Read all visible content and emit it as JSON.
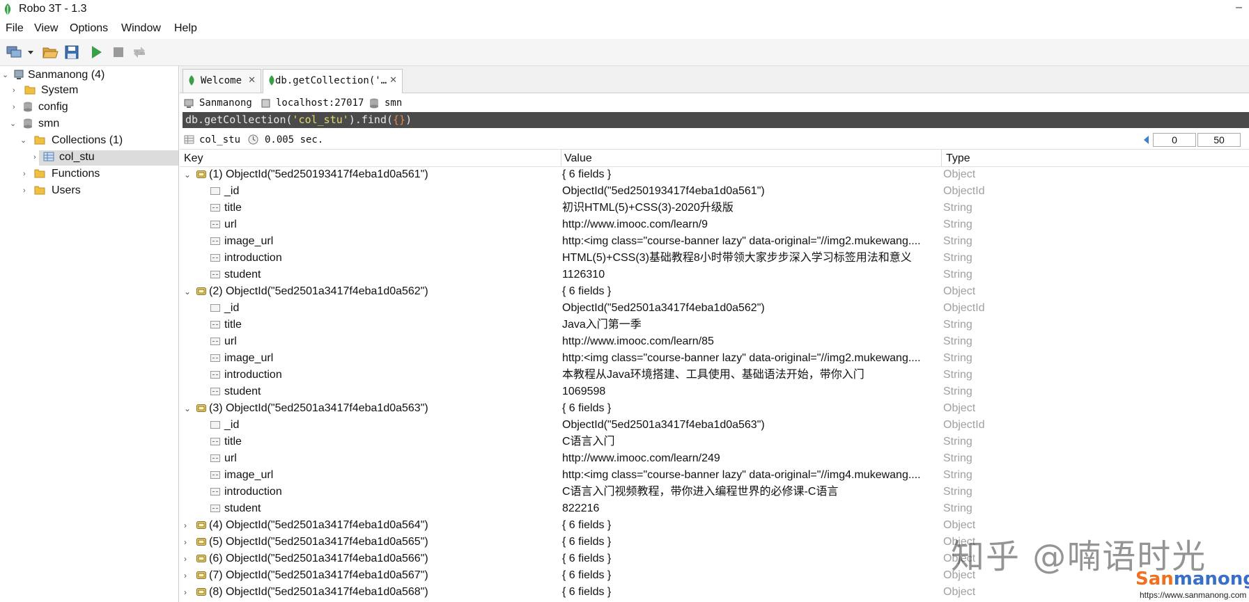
{
  "window": {
    "title": "Robo 3T - 1.3",
    "minimize": "–"
  },
  "menu": [
    "File",
    "View",
    "Options",
    "Window",
    "Help"
  ],
  "sidebar": {
    "server": "Sanmanong (4)",
    "items": [
      "System",
      "config",
      "smn",
      "Collections (1)",
      "col_stu",
      "Functions",
      "Users"
    ]
  },
  "tabs": [
    {
      "label": "Welcome"
    },
    {
      "label": "db.getCollection('…"
    }
  ],
  "connection": {
    "name": "Sanmanong",
    "host": "localhost:27017",
    "db": "smn"
  },
  "query": {
    "p1": "db.getCollection(",
    "s1": "'col_stu'",
    "p2": ").find(",
    "p3": "{}",
    "p4": ")"
  },
  "result": {
    "collection": "col_stu",
    "time": "0.005 sec.",
    "skip": "0",
    "limit": "50"
  },
  "grid": {
    "headers": {
      "key": "Key",
      "value": "Value",
      "type": "Type"
    },
    "rows": [
      {
        "level": 0,
        "expanded": true,
        "key": "(1) ObjectId(\"5ed250193417f4eba1d0a561\")",
        "value": "{ 6 fields }",
        "type": "Object"
      },
      {
        "level": 1,
        "icon": "id",
        "key": "_id",
        "value": "ObjectId(\"5ed250193417f4eba1d0a561\")",
        "type": "ObjectId"
      },
      {
        "level": 1,
        "icon": "str",
        "key": "title",
        "value": "初识HTML(5)+CSS(3)-2020升级版",
        "type": "String"
      },
      {
        "level": 1,
        "icon": "str",
        "key": "url",
        "value": "http://www.imooc.com/learn/9",
        "type": "String"
      },
      {
        "level": 1,
        "icon": "str",
        "key": "image_url",
        "value": "http:<img class=\"course-banner lazy\" data-original=\"//img2.mukewang....",
        "type": "String"
      },
      {
        "level": 1,
        "icon": "str",
        "key": "introduction",
        "value": "HTML(5)+CSS(3)基础教程8小时带领大家步步深入学习标签用法和意义",
        "type": "String"
      },
      {
        "level": 1,
        "icon": "str",
        "key": "student",
        "value": "1126310",
        "type": "String"
      },
      {
        "level": 0,
        "expanded": true,
        "key": "(2) ObjectId(\"5ed2501a3417f4eba1d0a562\")",
        "value": "{ 6 fields }",
        "type": "Object"
      },
      {
        "level": 1,
        "icon": "id",
        "key": "_id",
        "value": "ObjectId(\"5ed2501a3417f4eba1d0a562\")",
        "type": "ObjectId"
      },
      {
        "level": 1,
        "icon": "str",
        "key": "title",
        "value": "Java入门第一季",
        "type": "String"
      },
      {
        "level": 1,
        "icon": "str",
        "key": "url",
        "value": "http://www.imooc.com/learn/85",
        "type": "String"
      },
      {
        "level": 1,
        "icon": "str",
        "key": "image_url",
        "value": "http:<img class=\"course-banner lazy\" data-original=\"//img2.mukewang....",
        "type": "String"
      },
      {
        "level": 1,
        "icon": "str",
        "key": "introduction",
        "value": "本教程从Java环境搭建、工具使用、基础语法开始，带你入门",
        "type": "String"
      },
      {
        "level": 1,
        "icon": "str",
        "key": "student",
        "value": "1069598",
        "type": "String"
      },
      {
        "level": 0,
        "expanded": true,
        "key": "(3) ObjectId(\"5ed2501a3417f4eba1d0a563\")",
        "value": "{ 6 fields }",
        "type": "Object"
      },
      {
        "level": 1,
        "icon": "id",
        "key": "_id",
        "value": "ObjectId(\"5ed2501a3417f4eba1d0a563\")",
        "type": "ObjectId"
      },
      {
        "level": 1,
        "icon": "str",
        "key": "title",
        "value": "C语言入门",
        "type": "String"
      },
      {
        "level": 1,
        "icon": "str",
        "key": "url",
        "value": "http://www.imooc.com/learn/249",
        "type": "String"
      },
      {
        "level": 1,
        "icon": "str",
        "key": "image_url",
        "value": "http:<img class=\"course-banner lazy\" data-original=\"//img4.mukewang....",
        "type": "String"
      },
      {
        "level": 1,
        "icon": "str",
        "key": "introduction",
        "value": "C语言入门视频教程，带你进入编程世界的必修课-C语言",
        "type": "String"
      },
      {
        "level": 1,
        "icon": "str",
        "key": "student",
        "value": "822216",
        "type": "String"
      },
      {
        "level": 0,
        "expanded": false,
        "key": "(4) ObjectId(\"5ed2501a3417f4eba1d0a564\")",
        "value": "{ 6 fields }",
        "type": "Object"
      },
      {
        "level": 0,
        "expanded": false,
        "key": "(5) ObjectId(\"5ed2501a3417f4eba1d0a565\")",
        "value": "{ 6 fields }",
        "type": "Object"
      },
      {
        "level": 0,
        "expanded": false,
        "key": "(6) ObjectId(\"5ed2501a3417f4eba1d0a566\")",
        "value": "{ 6 fields }",
        "type": "Object"
      },
      {
        "level": 0,
        "expanded": false,
        "key": "(7) ObjectId(\"5ed2501a3417f4eba1d0a567\")",
        "value": "{ 6 fields }",
        "type": "Object"
      },
      {
        "level": 0,
        "expanded": false,
        "key": "(8) ObjectId(\"5ed2501a3417f4eba1d0a568\")",
        "value": "{ 6 fields }",
        "type": "Object"
      }
    ]
  },
  "watermark": {
    "text": "知乎 @喃语时光",
    "brand_a": "San",
    "brand_b": "manong",
    "url": "https://www.sanmanong.com"
  },
  "colors": {
    "accent_green": "#3aa048",
    "folder": "#f0c040",
    "brand_orange": "#f07020",
    "brand_blue": "#3a6fc8"
  }
}
